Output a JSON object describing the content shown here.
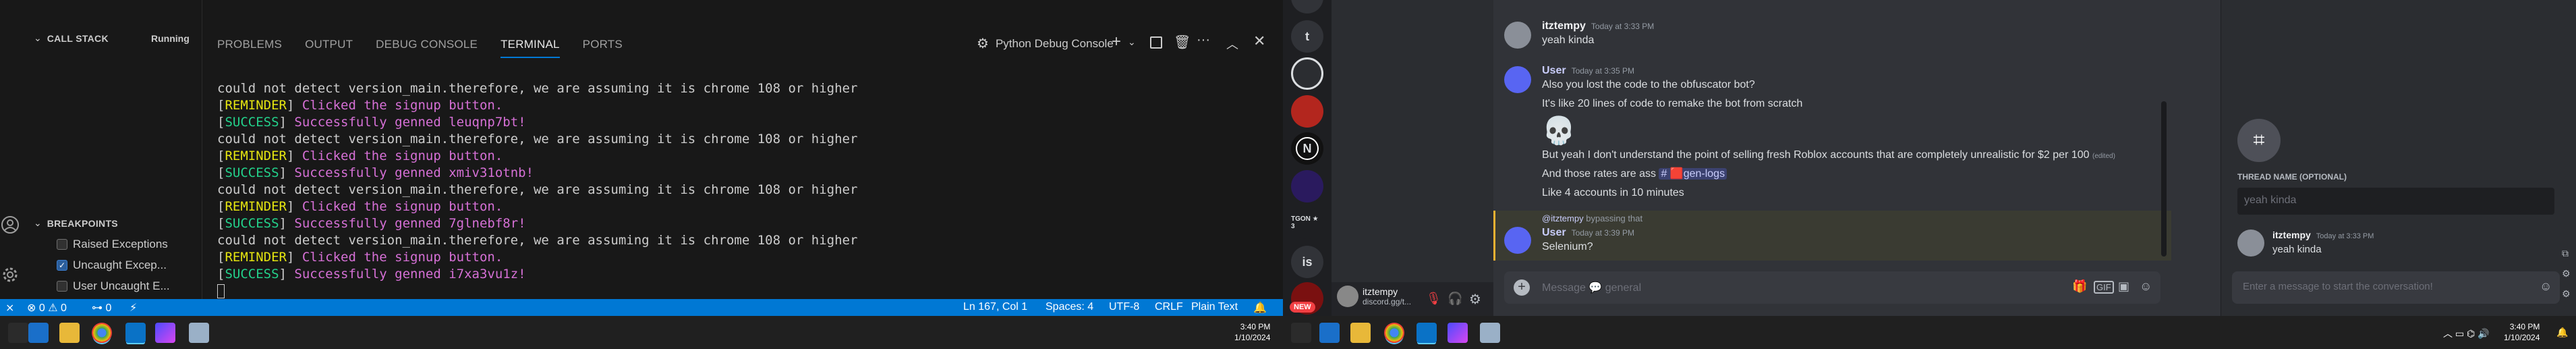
{
  "vscode": {
    "call_stack": {
      "title": "CALL STACK",
      "status": "Running"
    },
    "breakpoints": {
      "title": "BREAKPOINTS",
      "items": [
        {
          "label": "Raised Exceptions",
          "checked": false
        },
        {
          "label": "Uncaught Excep...",
          "checked": true
        },
        {
          "label": "User Uncaught E...",
          "checked": false
        }
      ]
    },
    "panel_tabs": [
      "PROBLEMS",
      "OUTPUT",
      "DEBUG CONSOLE",
      "TERMINAL",
      "PORTS"
    ],
    "terminal_profile": "Python Debug Console",
    "terminal": {
      "l1": "could not detect version_main.therefore, we are assuming it is chrome 108 or higher",
      "r1": "REMINDER",
      "r1_msg": " Clicked the signup button.",
      "s1": "SUCCESS",
      "s1_msg": " Successfully genned leuqnp7bt!",
      "l2": "could not detect version_main.therefore, we are assuming it is chrome 108 or higher",
      "r2": "REMINDER",
      "r2_msg": " Clicked the signup button.",
      "s2": "SUCCESS",
      "s2_msg": " Successfully genned xmiv31otnb!",
      "l3": "could not detect version_main.therefore, we are assuming it is chrome 108 or higher",
      "r3": "REMINDER",
      "r3_msg": " Clicked the signup button.",
      "s3": "SUCCESS",
      "s3_msg": " Successfully genned 7glnebf8r!",
      "l4": "could not detect version_main.therefore, we are assuming it is chrome 108 or higher",
      "r4": "REMINDER",
      "r4_msg": " Clicked the signup button.",
      "s4": "SUCCESS",
      "s4_msg": " Successfully genned i7xa3vu1z!"
    },
    "status": {
      "errors": "0",
      "warnings": "0",
      "ports": "0",
      "position": "Ln 167, Col 1",
      "spaces": "Spaces: 4",
      "encoding": "UTF-8",
      "eol": "CRLF",
      "language": "Plain Text"
    }
  },
  "taskbar_left": {
    "time": "3:40 PM",
    "date": "1/10/2024"
  },
  "taskbar_right": {
    "time": "3:40 PM",
    "date": "1/10/2024"
  },
  "discord": {
    "guilds": [
      "t",
      "N",
      "is"
    ],
    "guild_badge": "TGON ★ 3",
    "new_badge": "NEW",
    "user": {
      "name": "itztempy",
      "status": "discord.gg/t..."
    },
    "messages": {
      "m1_user": "itztempy",
      "m1_ts": "Today at 3:33 PM",
      "m1_text": "yeah kinda",
      "m2_user": "User",
      "m2_ts": "Today at 3:35 PM",
      "m2_l1": "Also you lost the code to the obfuscator bot?",
      "m2_l2": "It's like 20 lines of code to remake the bot from scratch",
      "m2_l3": "But yeah I don't understand the point of selling fresh Roblox accounts that are completely unrealistic for $2 per 100",
      "m2_edited": "(edited)",
      "m2_l4": "And those rates are ass",
      "m2_channel": "gen-logs",
      "m2_l5": "Like 4 accounts in 10 minutes",
      "reply_user": "@itztempy",
      "reply_text": "bypassing that",
      "m3_user": "User",
      "m3_ts": "Today at 3:39 PM",
      "m3_text": "Selenium?"
    },
    "composer_placeholder": "Message ",
    "composer_channel": "general",
    "thread": {
      "name_label": "THREAD NAME (OPTIONAL)",
      "name_placeholder": "yeah kinda",
      "starter_user": "itztempy",
      "starter_ts": "Today at 3:33 PM",
      "starter_text": "yeah kinda",
      "input_placeholder": "Enter a message to start the conversation!"
    }
  },
  "colors": {
    "accent": "#0078d4",
    "discord_bg": "#313338",
    "blurple": "#5865f2"
  }
}
